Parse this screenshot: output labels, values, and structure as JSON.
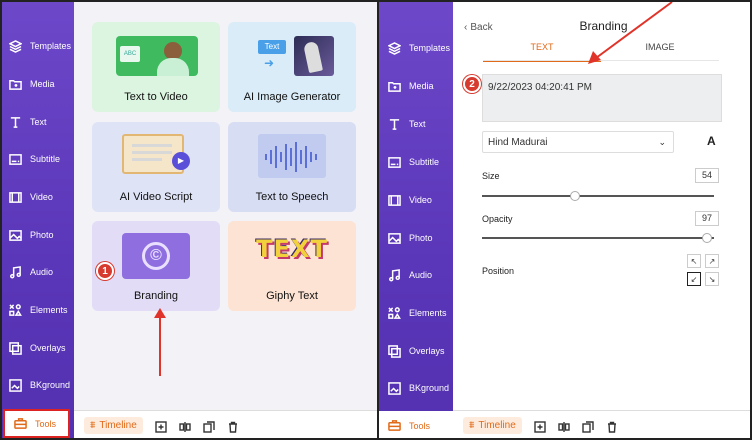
{
  "sidebar_items": [
    {
      "label": "Templates",
      "icon": "layers-icon"
    },
    {
      "label": "Media",
      "icon": "folder-icon"
    },
    {
      "label": "Text",
      "icon": "text-icon"
    },
    {
      "label": "Subtitle",
      "icon": "subtitle-icon"
    },
    {
      "label": "Video",
      "icon": "video-icon"
    },
    {
      "label": "Photo",
      "icon": "photo-icon"
    },
    {
      "label": "Audio",
      "icon": "music-icon"
    },
    {
      "label": "Elements",
      "icon": "elements-icon"
    },
    {
      "label": "Overlays",
      "icon": "overlays-icon"
    },
    {
      "label": "BKground",
      "icon": "background-icon"
    },
    {
      "label": "Tools",
      "icon": "toolbox-icon"
    }
  ],
  "tools": {
    "text_to_video": "Text to Video",
    "ai_image_generator": "AI Image Generator",
    "ai_video_script": "AI Video Script",
    "text_to_speech": "Text to Speech",
    "branding": "Branding",
    "giphy_text": "Giphy Text"
  },
  "thumb_text": {
    "abc": "ABC",
    "text_tag": "Text",
    "giphy_art": "TEXT"
  },
  "bottom_bar": {
    "timeline_label": "Timeline"
  },
  "badges": {
    "step1": "1",
    "step2": "2"
  },
  "branding_panel": {
    "back_label": "Back",
    "title": "Branding",
    "tab_text": "TEXT",
    "tab_image": "IMAGE",
    "text_value": "9/22/2023 04:20:41 PM",
    "font_value": "Hind Madurai",
    "size_label": "Size",
    "size_value": "54",
    "size_fraction": 0.4,
    "opacity_label": "Opacity",
    "opacity_value": "97",
    "opacity_fraction": 0.97,
    "position_label": "Position"
  },
  "colors": {
    "sidebar": "#5a36b8",
    "accent_orange": "#e16a1a",
    "annotation_red": "#d73b2f"
  }
}
